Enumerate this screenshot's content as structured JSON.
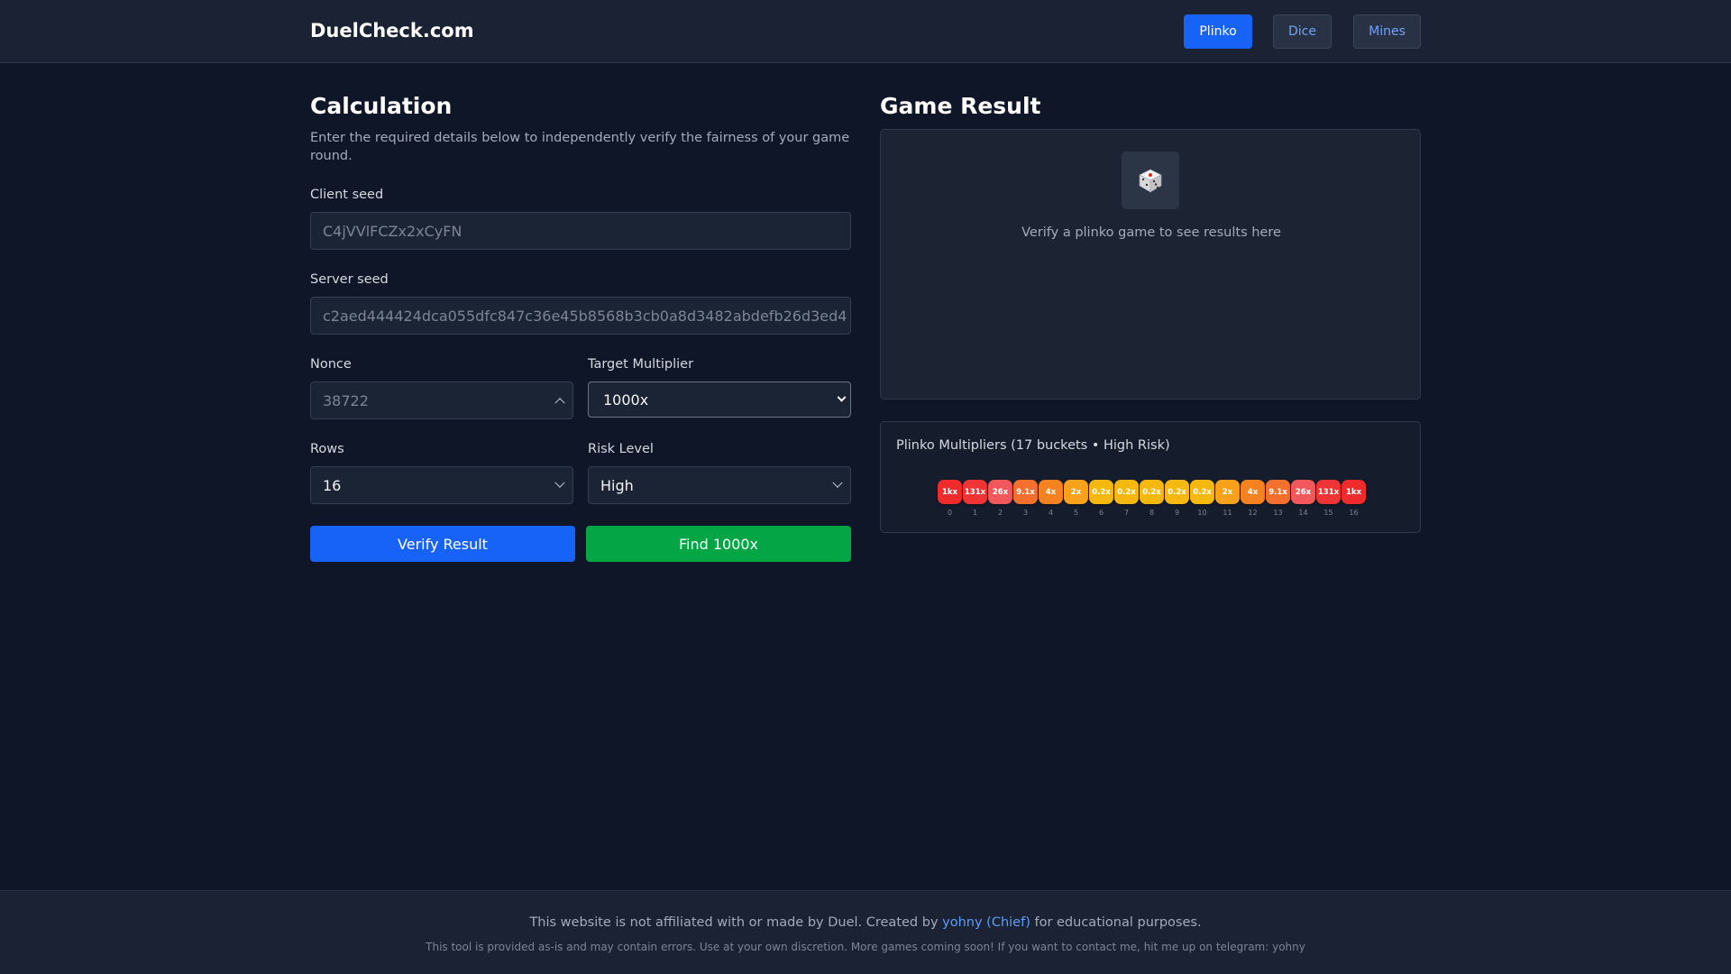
{
  "header": {
    "brand": "DuelCheck.com",
    "nav": [
      {
        "label": "Plinko",
        "active": true
      },
      {
        "label": "Dice",
        "active": false
      },
      {
        "label": "Mines",
        "active": false
      }
    ]
  },
  "calculation": {
    "title": "Calculation",
    "intro": "Enter the required details below to independently verify the fairness of your game round.",
    "client_seed": {
      "label": "Client seed",
      "placeholder": "C4jVVlFCZx2xCyFN"
    },
    "server_seed": {
      "label": "Server seed",
      "placeholder": "c2aed444424dca055dfc847c36e45b8568b3cb0a8d3482abdefb26d3ed4"
    },
    "nonce": {
      "label": "Nonce",
      "placeholder": "38722"
    },
    "target_multiplier": {
      "label": "Target Multiplier",
      "value": "1000x"
    },
    "rows": {
      "label": "Rows",
      "value": "16"
    },
    "risk_level": {
      "label": "Risk Level",
      "value": "High"
    },
    "verify_button": "Verify Result",
    "find_button": "Find 1000x"
  },
  "game_result": {
    "title": "Game Result",
    "dice_icon": "dice-icon",
    "hint": "Verify a plinko game to see results here"
  },
  "multipliers": {
    "title": "Plinko Multipliers (17 buckets • High Risk)",
    "buckets": [
      {
        "label": "1kx",
        "index": "0",
        "color": "#ef2b2b"
      },
      {
        "label": "131x",
        "index": "1",
        "color": "#ee3434"
      },
      {
        "label": "26x",
        "index": "2",
        "color": "#f0585b"
      },
      {
        "label": "9.1x",
        "index": "3",
        "color": "#f26f2e"
      },
      {
        "label": "4x",
        "index": "4",
        "color": "#f58221"
      },
      {
        "label": "2x",
        "index": "5",
        "color": "#f7a21a"
      },
      {
        "label": "0.2x",
        "index": "6",
        "color": "#f5b80e"
      },
      {
        "label": "0.2x",
        "index": "7",
        "color": "#f5b80e"
      },
      {
        "label": "0.2x",
        "index": "8",
        "color": "#f5b80e"
      },
      {
        "label": "0.2x",
        "index": "9",
        "color": "#f5b80e"
      },
      {
        "label": "0.2x",
        "index": "10",
        "color": "#f5b80e"
      },
      {
        "label": "2x",
        "index": "11",
        "color": "#f7a21a"
      },
      {
        "label": "4x",
        "index": "12",
        "color": "#f58221"
      },
      {
        "label": "9.1x",
        "index": "13",
        "color": "#f26f2e"
      },
      {
        "label": "26x",
        "index": "14",
        "color": "#f0585b"
      },
      {
        "label": "131x",
        "index": "15",
        "color": "#ee3434"
      },
      {
        "label": "1kx",
        "index": "16",
        "color": "#ef2b2b"
      }
    ]
  },
  "footer": {
    "text_before": "This website is not affiliated with or made by Duel. Created by ",
    "link": "yohny (Chief)",
    "text_after": " for educational purposes.",
    "sub": "This tool is provided as-is and may contain errors. Use at your own discretion. More games coming soon! If you want to contact me, hit me up on telegram: yohny"
  }
}
